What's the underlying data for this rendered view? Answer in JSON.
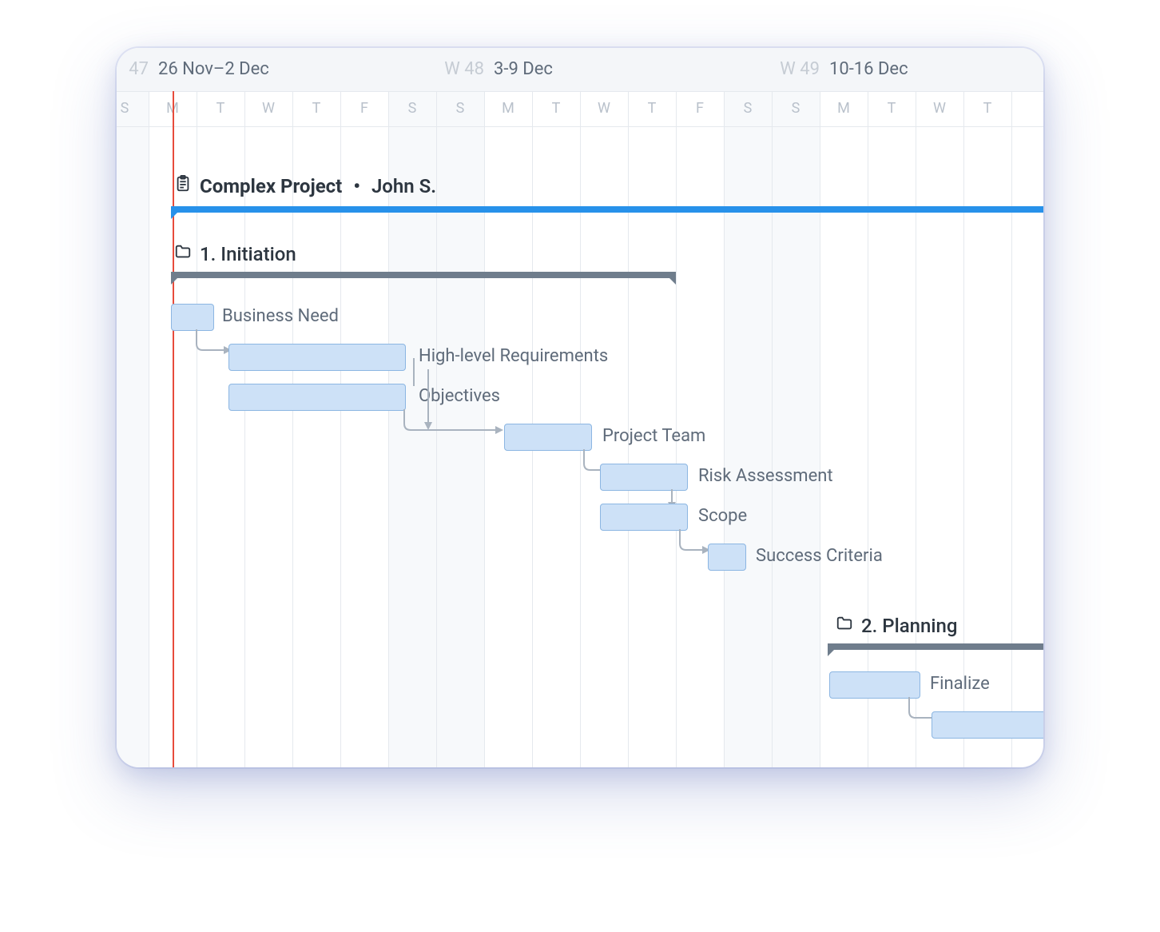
{
  "timeline": {
    "weeks": [
      {
        "range_label": "26 Nov–2 Dec",
        "week_number": "W 48"
      },
      {
        "range_label": "3-9 Dec",
        "week_number": "W 49"
      },
      {
        "range_label": "10-16 Dec",
        "week_number": ""
      }
    ],
    "prev_week_number": "47",
    "days": [
      "S",
      "M",
      "T",
      "W",
      "T",
      "F",
      "S",
      "S",
      "M",
      "T",
      "W",
      "T",
      "F",
      "S",
      "S",
      "M",
      "T",
      "W",
      "T"
    ],
    "weekend_indexes": [
      0,
      6,
      7,
      13,
      14
    ],
    "today_index": 1
  },
  "project": {
    "title": "Complex Project",
    "owner": "John S."
  },
  "groups": [
    {
      "title": "1. Initiation"
    },
    {
      "title": "2. Planning"
    }
  ],
  "tasks": [
    {
      "label": "Business Need"
    },
    {
      "label": "High-level Requirements"
    },
    {
      "label": "Objectives"
    },
    {
      "label": "Project Team"
    },
    {
      "label": "Risk Assessment"
    },
    {
      "label": "Scope"
    },
    {
      "label": "Success Criteria"
    },
    {
      "label": "Finalize"
    }
  ]
}
